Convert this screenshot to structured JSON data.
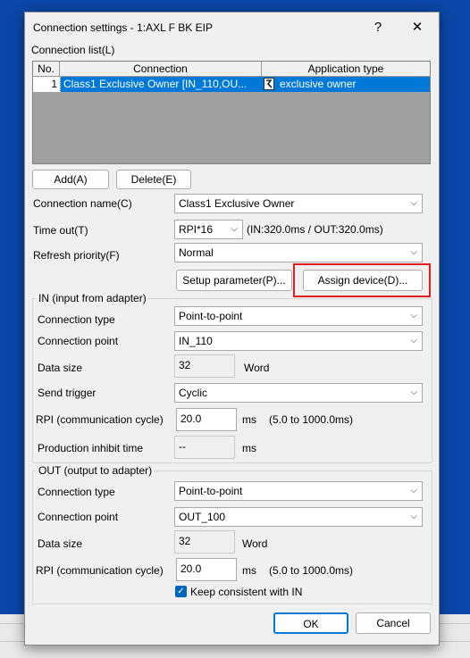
{
  "dialog": {
    "title": "Connection settings  - 1:AXL F BK EIP",
    "help_glyph": "?",
    "close_glyph": "✕"
  },
  "connection_list": {
    "label": "Connection list(L)",
    "columns": [
      "No.",
      "Connection",
      "Application type"
    ],
    "rows": [
      {
        "no": "1",
        "connection": "Class1 Exclusive Owner [IN_110,OU...",
        "application_type": "exclusive owner"
      }
    ],
    "add_label": "Add(A)",
    "delete_label": "Delete(E)"
  },
  "connection_name": {
    "label": "Connection name(C)",
    "value": "Class1 Exclusive Owner"
  },
  "timeout": {
    "label": "Time out(T)",
    "value": "RPI*16",
    "info": "(IN:320.0ms / OUT:320.0ms)"
  },
  "refresh_priority": {
    "label": "Refresh priority(F)",
    "value": "Normal"
  },
  "buttons": {
    "setup_parameter": "Setup parameter(P)...",
    "assign_device": "Assign device(D)...",
    "ok": "OK",
    "cancel": "Cancel"
  },
  "in_group": {
    "title": "IN (input from adapter)",
    "connection_type_label": "Connection type",
    "connection_type_value": "Point-to-point",
    "connection_point_label": "Connection point",
    "connection_point_value": "IN_110",
    "data_size_label": "Data size",
    "data_size_value": "32",
    "data_size_unit": "Word",
    "send_trigger_label": "Send trigger",
    "send_trigger_value": "Cyclic",
    "rpi_label": "RPI (communication cycle)",
    "rpi_value": "20.0",
    "rpi_unit": "ms",
    "rpi_range": "(5.0 to 1000.0ms)",
    "production_inhibit_label": "Production inhibit time",
    "production_inhibit_value": "--",
    "production_inhibit_unit": "ms"
  },
  "out_group": {
    "title": "OUT (output to adapter)",
    "connection_type_label": "Connection type",
    "connection_type_value": "Point-to-point",
    "connection_point_label": "Connection point",
    "connection_point_value": "OUT_100",
    "data_size_label": "Data size",
    "data_size_value": "32",
    "data_size_unit": "Word",
    "rpi_label": "RPI (communication cycle)",
    "rpi_value": "20.0",
    "rpi_unit": "ms",
    "rpi_range": "(5.0 to 1000.0ms)",
    "keep_consistent_label": "Keep consistent with IN",
    "keep_consistent_checked": true
  },
  "colors": {
    "desktop": "#0b47a8",
    "selection": "#0078d7",
    "highlight_box": "#e02020",
    "checkbox": "#0067c0"
  },
  "icons": [
    "help-icon",
    "close-icon",
    "dropdown-arrow-icon",
    "eds-device-icon",
    "checkmark-icon"
  ]
}
